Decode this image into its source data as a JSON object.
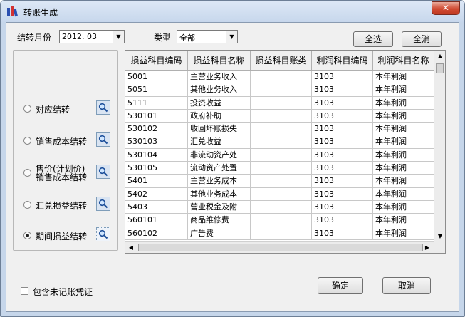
{
  "window": {
    "title": "转账生成",
    "close_glyph": "✕"
  },
  "filters": {
    "month_label": "结转月份",
    "month_value": "2012. 03",
    "type_label": "类型",
    "type_value": "全部"
  },
  "toolbar": {
    "select_all": "全选",
    "clear_all": "全消"
  },
  "options": [
    {
      "label": "对应结转",
      "checked": false
    },
    {
      "label": "销售成本结转",
      "checked": false
    },
    {
      "label_line1": "售价(计划价)",
      "label_line2": "销售成本结转",
      "checked": false
    },
    {
      "label": "汇兑损益结转",
      "checked": false
    },
    {
      "label": "期间损益结转",
      "checked": true
    }
  ],
  "table": {
    "columns": [
      "损益科目编码",
      "损益科目名称",
      "损益科目账类",
      "利润科目编码",
      "利润科目名称"
    ],
    "rows": [
      [
        "5001",
        "主营业务收入",
        "",
        "3103",
        "本年利润"
      ],
      [
        "5051",
        "其他业务收入",
        "",
        "3103",
        "本年利润"
      ],
      [
        "5111",
        "投资收益",
        "",
        "3103",
        "本年利润"
      ],
      [
        "530101",
        "政府补助",
        "",
        "3103",
        "本年利润"
      ],
      [
        "530102",
        "收回坏账损失",
        "",
        "3103",
        "本年利润"
      ],
      [
        "530103",
        "汇兑收益",
        "",
        "3103",
        "本年利润"
      ],
      [
        "530104",
        "非流动资产处",
        "",
        "3103",
        "本年利润"
      ],
      [
        "530105",
        "流动资产处置",
        "",
        "3103",
        "本年利润"
      ],
      [
        "5401",
        "主营业务成本",
        "",
        "3103",
        "本年利润"
      ],
      [
        "5402",
        "其他业务成本",
        "",
        "3103",
        "本年利润"
      ],
      [
        "5403",
        "营业税金及附",
        "",
        "3103",
        "本年利润"
      ],
      [
        "560101",
        "商品维修费",
        "",
        "3103",
        "本年利润"
      ],
      [
        "560102",
        "广告费",
        "",
        "3103",
        "本年利润"
      ]
    ]
  },
  "footer": {
    "include_unposted_label": "包含未记账凭证",
    "ok_label": "确定",
    "cancel_label": "取消"
  }
}
